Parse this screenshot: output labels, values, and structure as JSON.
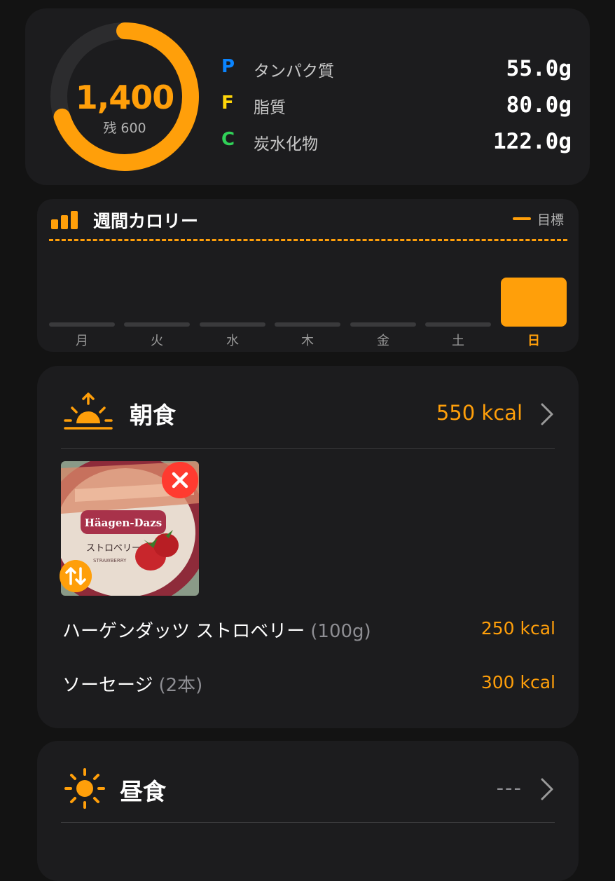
{
  "summary": {
    "calories": "1,400",
    "remaining": "残 600",
    "progress_fraction": 0.7,
    "macros": [
      {
        "letter": "P",
        "name": "タンパク質",
        "value": "55.0g",
        "color": "#0a84ff"
      },
      {
        "letter": "F",
        "name": "脂質",
        "value": "80.0g",
        "color": "#ffd60a"
      },
      {
        "letter": "C",
        "name": "炭水化物",
        "value": "122.0g",
        "color": "#30d158"
      }
    ]
  },
  "weekly": {
    "title": "週間カロリー",
    "legend": "目標",
    "days": [
      "月",
      "火",
      "水",
      "木",
      "金",
      "土",
      "日"
    ],
    "active_day": "日",
    "accent": "#ff9f0a"
  },
  "breakfast": {
    "title": "朝食",
    "kcal": "550 kcal",
    "photo": {
      "brand": "Häagen-Dazs",
      "flavor_jp": "ストロベリー",
      "flavor_en": "STRAWBERRY"
    },
    "items": [
      {
        "name": "ハーゲンダッツ ストロベリー",
        "qty": "(100g)",
        "kcal": "250 kcal"
      },
      {
        "name": "ソーセージ",
        "qty": "(2本)",
        "kcal": "300 kcal"
      }
    ]
  },
  "lunch": {
    "title": "昼食",
    "kcal": "---"
  }
}
